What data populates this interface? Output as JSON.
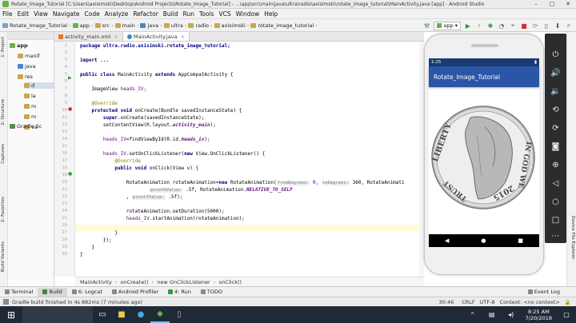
{
  "window": {
    "title": "Rotate_Image_Tutorial [C:\\Users\\axisimski\\Desktop\\Android Projects\\Rotate_Image_Tutorial] - ...\\app\\src\\main\\java\\ultra\\radio\\axisimski\\rotate_image_tutorial\\MainActivity.java [app] - Android Studio"
  },
  "menu": [
    "File",
    "Edit",
    "View",
    "Navigate",
    "Code",
    "Analyze",
    "Refactor",
    "Build",
    "Run",
    "Tools",
    "VCS",
    "Window",
    "Help"
  ],
  "breadcrumbs": [
    "Rotate_Image_Tutorial",
    "app",
    "src",
    "main",
    "java",
    "ultra",
    "radio",
    "axisimski",
    "rotate_image_tutorial"
  ],
  "toolbar": {
    "device": "app"
  },
  "left_tabs": {
    "project": "1: Project",
    "structure": "2: Structure",
    "captures": "Captures",
    "favorites": "2: Favorites",
    "build_variants": "Build Variants"
  },
  "right_tabs": {
    "device_file_explorer": "Device File Explorer"
  },
  "project_tree": [
    {
      "label": "app",
      "depth": 0
    },
    {
      "label": "manif",
      "depth": 1
    },
    {
      "label": "java",
      "depth": 1
    },
    {
      "label": "res",
      "depth": 1
    },
    {
      "label": "d",
      "depth": 2
    },
    {
      "label": "la",
      "depth": 2
    },
    {
      "label": "m",
      "depth": 2
    },
    {
      "label": "m",
      "depth": 2
    },
    {
      "label": "va",
      "depth": 2
    },
    {
      "label": "Gradle Sc",
      "depth": 0
    }
  ],
  "editor_tabs": [
    {
      "label": "activity_main.xml",
      "active": false
    },
    {
      "label": "MainActivity.java",
      "active": true
    }
  ],
  "line_numbers": [
    "1",
    "2",
    "3",
    "4",
    "5",
    "6",
    "7",
    "8",
    "9",
    "10",
    "11",
    "12",
    "13",
    "14",
    "15",
    "16",
    "17",
    "18",
    "19",
    "20",
    "21",
    "22",
    "23",
    "24",
    "25",
    "26",
    "27",
    "28",
    "29",
    "30"
  ],
  "code": {
    "l1": "package ultra.radio.axisimski.rotate_image_tutorial;",
    "l3": "import ...",
    "l5a": "public class ",
    "l5b": "MainActivity ",
    "l5c": "extends ",
    "l5d": "AppCompatActivity {",
    "l7a": "ImageView ",
    "l7b": "heads_IV;",
    "l9": "@Override",
    "l10a": "protected void ",
    "l10b": "onCreate(Bundle savedInstanceState) {",
    "l11a": "super",
    "l11b": ".onCreate(savedInstanceState);",
    "l12a": "setContentView(R.layout.",
    "l12b": "activity_main",
    "l12c": ");",
    "l14a": "heads_IV",
    "l14b": "=findViewById(R.id.",
    "l14c": "heads_iv",
    "l14d": ");",
    "l16a": "heads_IV",
    "l16b": ".setOnClickListener(",
    "l16c": "new ",
    "l16d": "View.OnClickListener() {",
    "l17": "@Override",
    "l18a": "public void ",
    "l18b": "onClick(View v) {",
    "l20a": "RotateAnimation rotateAnimation=",
    "l20b": "new ",
    "l20c": "RotateAnimation(",
    "h_from": "fromDegrees:",
    "l20d": "0, ",
    "h_to": "toDegrees:",
    "l20e": "360, RotateAnimati",
    "h_pivotx": "pivotXValue:",
    "l21a": ".5f, RotateAnimation.",
    "l21b": "RELATIVE_TO_SELF",
    "l22a": ", ",
    "h_pivoty": "pivotYValue:",
    "l22b": ".5f);",
    "l24": "rotateAnimation.setDuration(5000);",
    "l25a": "heads_IV",
    "l25b": ".startAnimation(rotateAnimation);",
    "l27": "}",
    "l28": "});",
    "l29": "}",
    "l30": "}"
  },
  "editor_breadcrumb": [
    "MainActivity",
    "onCreate()",
    "new OnClickListener",
    "onClick()"
  ],
  "bottom_tabs": [
    "Terminal",
    "Build",
    "6: Logcat",
    "Android Profiler",
    "4: Run",
    "TODO"
  ],
  "bottom_right_tabs": [
    "Event Log"
  ],
  "status": {
    "message": "Gradle build finished in 4s 882ms (7 minutes ago)",
    "position": "30:46",
    "line_sep": "CRLF",
    "encoding": "UTF-8",
    "context": "Context: <no context>"
  },
  "phone": {
    "time": "1:25",
    "app_title": "Rotate_Image_Tutorial"
  },
  "coin": {
    "words": [
      "IN GOD WE",
      "TRUST",
      "LIBERTY",
      "2015"
    ]
  },
  "taskbar": {
    "search": "",
    "time": "8:25 AM",
    "date": "7/20/2018"
  },
  "colors": {
    "app_bar": "#2b56a8",
    "status_bar": "#1a3a72",
    "taskbar": "#1f2a36"
  }
}
